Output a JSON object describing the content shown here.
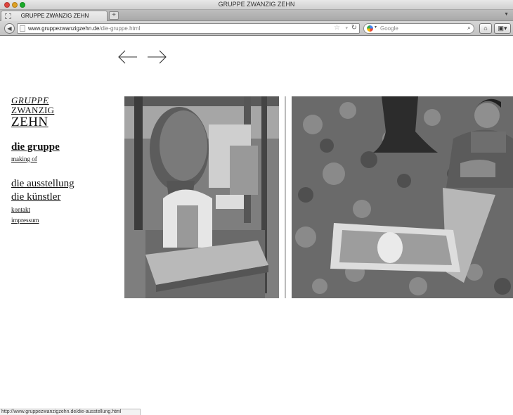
{
  "window": {
    "title": "GRUPPE ZWANZIG ZEHN"
  },
  "tab": {
    "label": "GRUPPE ZWANZIG ZEHN",
    "new_tab": "+"
  },
  "address": {
    "domain": "www.gruppezwanzigzehn.de",
    "path": "/die-gruppe.html"
  },
  "search": {
    "placeholder": "Google"
  },
  "site": {
    "logo": {
      "line1": "GRUPPE",
      "line2": "ZWANZIG",
      "line3": "ZEHN"
    },
    "nav": {
      "die_gruppe": "die gruppe",
      "making_of": "making of",
      "die_ausstellung": "die ausstellung",
      "die_kuenstler": "die künstler",
      "kontakt": "kontakt",
      "impressum": "impressum"
    }
  },
  "status": {
    "url": "http://www.gruppezwanzigzehn.de/die-ausstellung.html"
  },
  "icons": {
    "prev": "arrow-left-icon",
    "next": "arrow-right-icon",
    "back": "back-icon",
    "home": "home-icon",
    "bookmarks": "bookmarks-icon",
    "reload": "reload-icon",
    "search": "search-icon"
  }
}
